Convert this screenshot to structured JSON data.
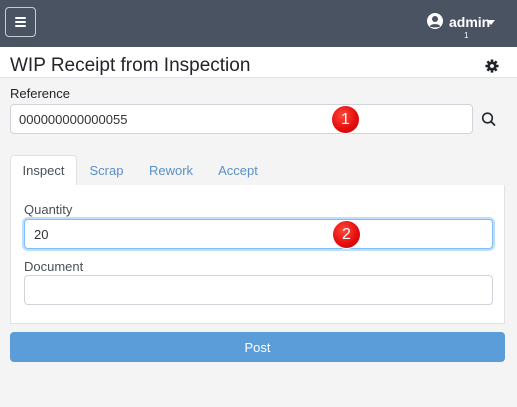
{
  "navbar": {
    "menu_icon": "hamburger-icon",
    "user": {
      "icon": "user-circle-icon",
      "name": "admin",
      "count": "1"
    }
  },
  "page": {
    "title": "WIP Receipt from Inspection",
    "settings_icon": "gear-icon"
  },
  "reference": {
    "label": "Reference",
    "value": "000000000000055",
    "search_icon": "search-icon",
    "marker": "1"
  },
  "tabs": [
    {
      "label": "Inspect",
      "active": true
    },
    {
      "label": "Scrap",
      "active": false
    },
    {
      "label": "Rework",
      "active": false
    },
    {
      "label": "Accept",
      "active": false
    }
  ],
  "inspect": {
    "quantity_label": "Quantity",
    "quantity_value": "20",
    "quantity_marker": "2",
    "document_label": "Document",
    "document_value": ""
  },
  "actions": {
    "post_label": "Post"
  },
  "colors": {
    "navbar": "#4a5361",
    "tab_link": "#5b8fc7",
    "post_button": "#5b9dd9",
    "marker": "#e60e0e"
  }
}
